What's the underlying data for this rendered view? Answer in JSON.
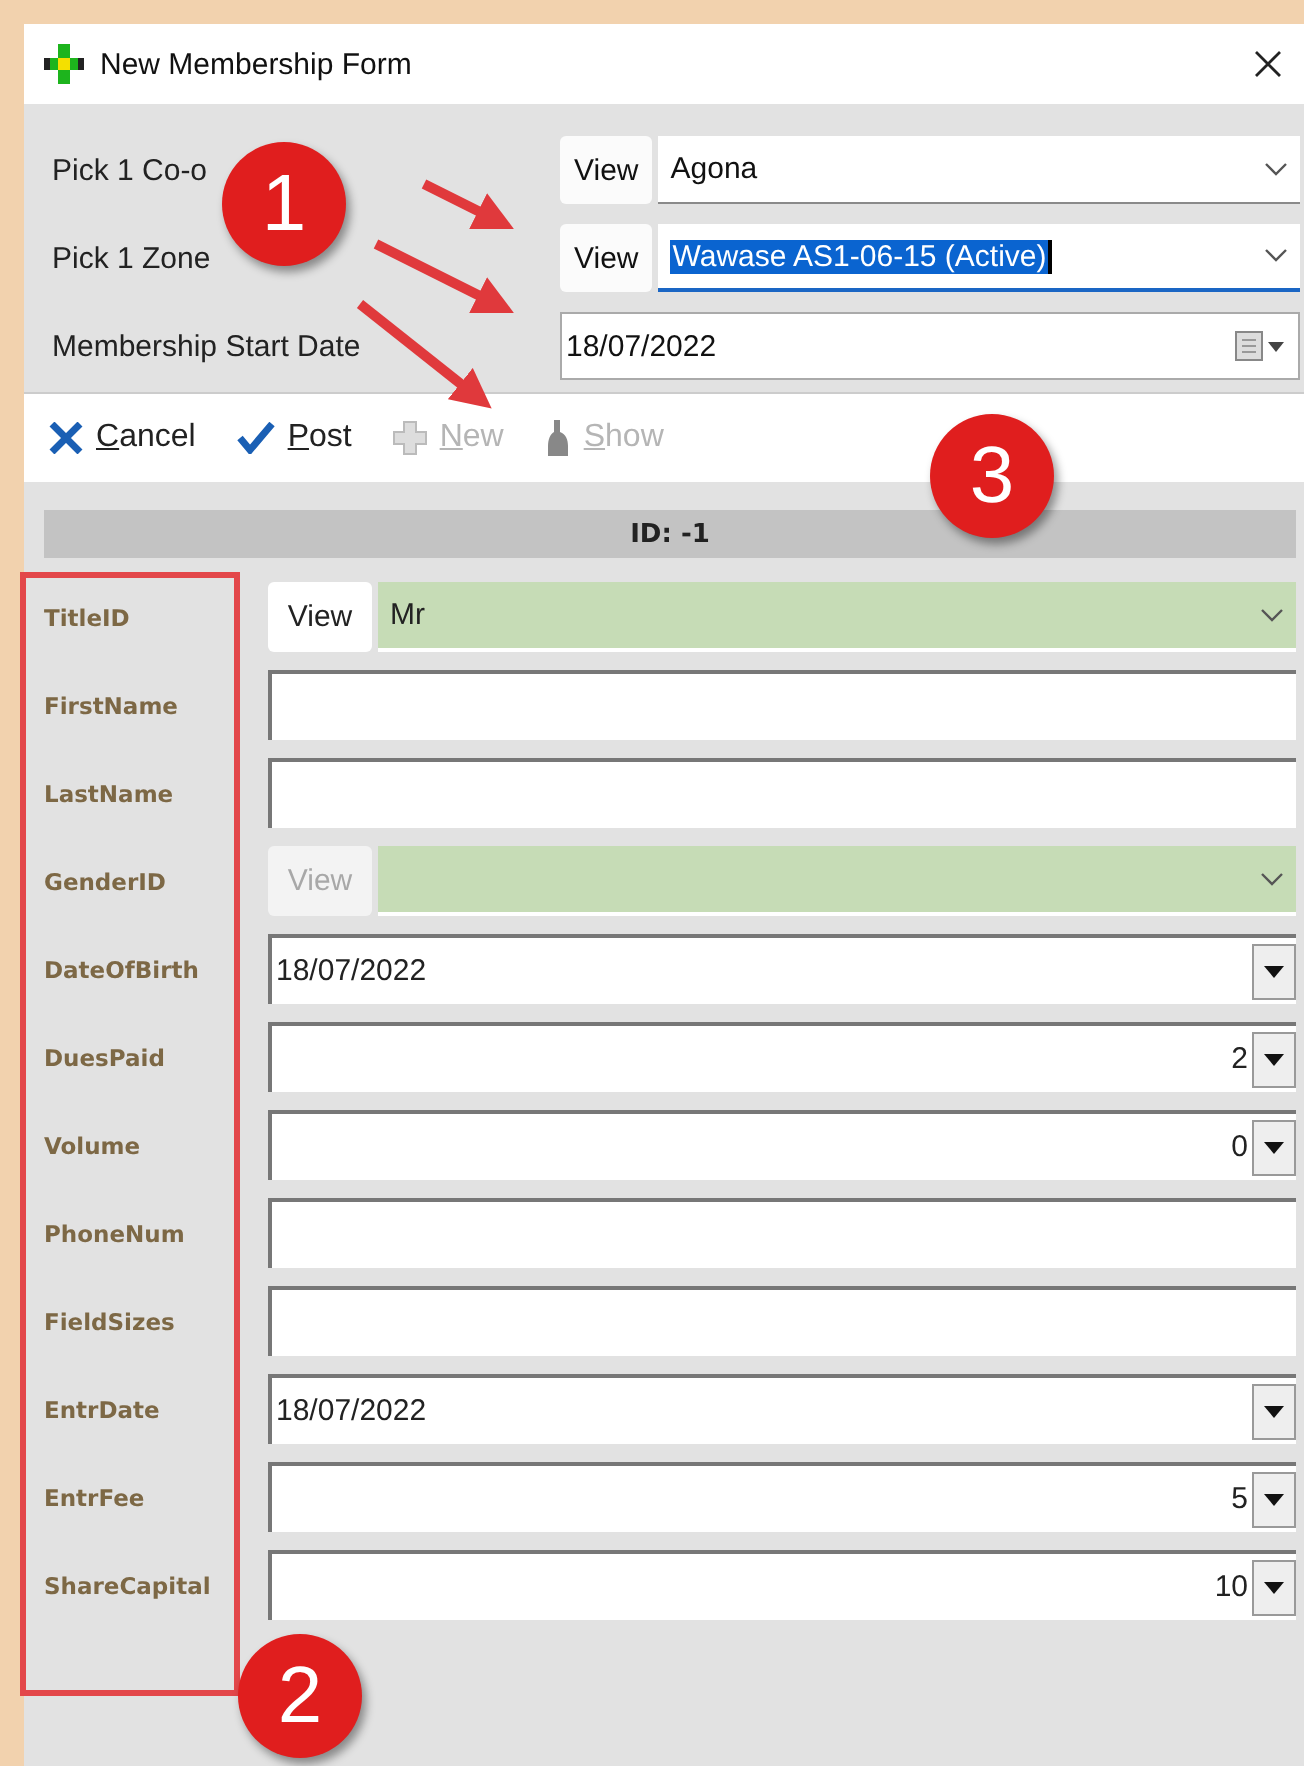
{
  "window": {
    "title": "New Membership Form"
  },
  "header_fields": [
    {
      "kind": "lookup",
      "label": "Pick 1 Co-o",
      "button": "View",
      "value": "Agona",
      "selected": false
    },
    {
      "kind": "lookup",
      "label": "Pick 1 Zone",
      "button": "View",
      "value": "Wawase AS1-06-15 (Active)",
      "selected": true
    },
    {
      "kind": "date",
      "label": "Membership Start Date",
      "value": "18/07/2022"
    }
  ],
  "toolbar": [
    {
      "kind": "cancel",
      "label": "Cancel",
      "disabled": false
    },
    {
      "kind": "post",
      "label": "Post",
      "disabled": false
    },
    {
      "kind": "new",
      "label": "New",
      "disabled": true
    },
    {
      "kind": "show",
      "label": "Show",
      "disabled": true
    }
  ],
  "record_header": "ID: -1",
  "fields": [
    {
      "kind": "lookup",
      "label": "TitleID",
      "button": "View",
      "button_disabled": false,
      "value": "Mr",
      "color": "#c6dcb6"
    },
    {
      "kind": "text",
      "label": "FirstName"
    },
    {
      "kind": "text",
      "label": "LastName"
    },
    {
      "kind": "lookup",
      "label": "GenderID",
      "button": "View",
      "button_disabled": true,
      "color": "#c6dcb6"
    },
    {
      "kind": "date",
      "label": "DateOfBirth",
      "value": "18/07/2022"
    },
    {
      "kind": "number",
      "label": "DuesPaid",
      "value": "2"
    },
    {
      "kind": "number",
      "label": "Volume",
      "value": "0"
    },
    {
      "kind": "text",
      "label": "PhoneNum"
    },
    {
      "kind": "text",
      "label": "FieldSizes"
    },
    {
      "kind": "date",
      "label": "EntrDate",
      "value": "18/07/2022"
    },
    {
      "kind": "number",
      "label": "EntrFee",
      "value": "5"
    },
    {
      "kind": "number",
      "label": "ShareCapital",
      "value": "10"
    }
  ],
  "annotations": [
    {
      "label": "1"
    },
    {
      "label": "3"
    },
    {
      "label": "2"
    }
  ]
}
